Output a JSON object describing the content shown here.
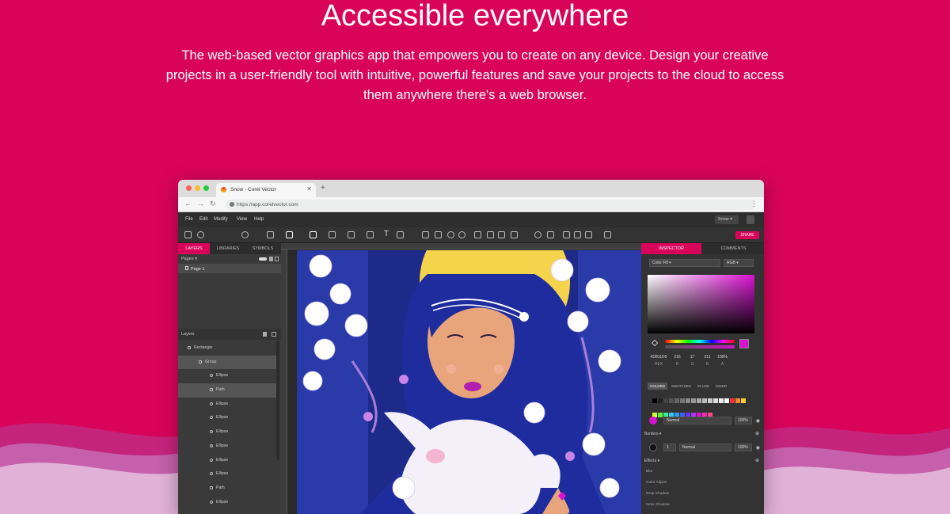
{
  "hero": {
    "title": "Accessible everywhere",
    "description": "The web-based vector graphics app that empowers you to create on any device. Design your creative projects in a user-friendly tool with intuitive, powerful features and save your projects to the cloud to access them anywhere there's a web browser."
  },
  "browser": {
    "tab_title": "Snow - Corel Vector",
    "tab_close": "✕",
    "new_tab": "+",
    "url": "https://app.corelvector.com"
  },
  "app": {
    "menu": [
      "File",
      "Edit",
      "Modify",
      "View",
      "Help"
    ],
    "document_name": "Snow",
    "share_label": "SHARE",
    "left_tabs": [
      "LAYERS",
      "LIBRARIES",
      "SYMBOLS"
    ],
    "pages_label": "Pages",
    "page_item": "Page 1",
    "layers_label": "Layers",
    "layers": [
      {
        "name": "Rectangle",
        "indent": 0,
        "selected": false
      },
      {
        "name": "Group",
        "indent": 1,
        "selected": true
      },
      {
        "name": "Ellipse",
        "indent": 2,
        "selected": false
      },
      {
        "name": "Path",
        "indent": 2,
        "selected": true
      },
      {
        "name": "Ellipse",
        "indent": 2,
        "selected": false
      },
      {
        "name": "Ellipse",
        "indent": 2,
        "selected": false
      },
      {
        "name": "Ellipse",
        "indent": 2,
        "selected": false
      },
      {
        "name": "Ellipse",
        "indent": 2,
        "selected": false
      },
      {
        "name": "Ellipse",
        "indent": 2,
        "selected": false
      },
      {
        "name": "Ellipse",
        "indent": 2,
        "selected": false
      },
      {
        "name": "Path",
        "indent": 2,
        "selected": false
      },
      {
        "name": "Ellipse",
        "indent": 2,
        "selected": false
      }
    ],
    "right_tabs": [
      "INSPECTOR",
      "COMMENTS"
    ],
    "fill_type": "Color Fill",
    "color_mode": "RGB",
    "color_values": [
      "#D811D0",
      "216",
      "17",
      "211",
      "100%"
    ],
    "color_value_labels": [
      "HEX",
      "R",
      "G",
      "B",
      "A"
    ],
    "color_tabs": [
      "COLORS",
      "SWATCHES",
      "IN USE",
      "MIXER"
    ],
    "blend_mode": "Normal",
    "fill_opacity": "100%",
    "borders_label": "Borders",
    "border_width": "1",
    "border_blend": "Normal",
    "border_opacity": "100%",
    "effects_label": "Effects",
    "effects": [
      "Blur",
      "Color Adjust",
      "Drop Shadow",
      "Inner Shadow"
    ]
  },
  "colors": {
    "brand": "#d9045a",
    "selected_fill": "#d811d0"
  }
}
